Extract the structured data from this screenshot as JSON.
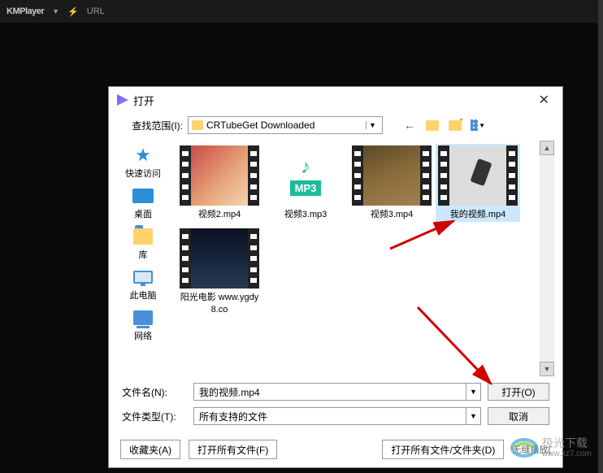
{
  "app": {
    "name": "KMPlayer",
    "url_label": "URL"
  },
  "dialog": {
    "title": "打开",
    "lookin_label": "查找范围(I):",
    "current_folder": "CRTubeGet Downloaded",
    "places": [
      {
        "label": "快速访问"
      },
      {
        "label": "桌面"
      },
      {
        "label": "库"
      },
      {
        "label": "此电脑"
      },
      {
        "label": "网络"
      }
    ],
    "files": [
      {
        "label": "视频2.mp4"
      },
      {
        "label": "视频3.mp3",
        "mp3": "MP3"
      },
      {
        "label": "视频3.mp4"
      },
      {
        "label": "我的视频.mp4"
      },
      {
        "label": "阳光电影 www.ygdy8.co"
      }
    ],
    "filename_label": "文件名(N):",
    "filename_value": "我的视频.mp4",
    "filetype_label": "文件类型(T):",
    "filetype_value": "所有支持的文件",
    "open_btn": "打开(O)",
    "cancel_btn": "取消",
    "favorites_btn": "收藏夹(A)",
    "open_all_btn": "打开所有文件(F)",
    "open_all_folder_btn": "打开所有文件/文件夹(D)",
    "seamless_label": "无缝播放("
  },
  "watermark": {
    "cn": "极光下载",
    "url": "www.xz7.com"
  }
}
